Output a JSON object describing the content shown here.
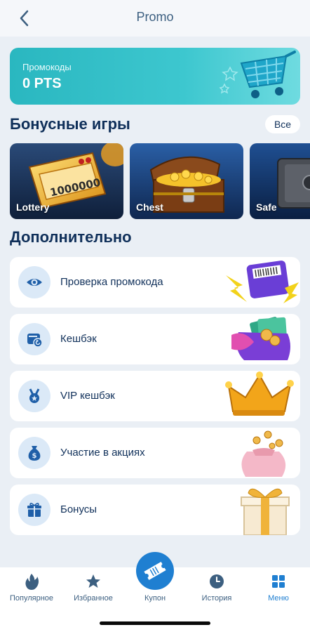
{
  "header": {
    "title": "Promo"
  },
  "promo": {
    "label": "Промокоды",
    "value": "0 PTS"
  },
  "bonus_games": {
    "title": "Бонусные игры",
    "all_label": "Все",
    "items": [
      {
        "label": "Lottery",
        "ticket_text": "1000000"
      },
      {
        "label": "Chest"
      },
      {
        "label": "Safe"
      }
    ]
  },
  "additional": {
    "title": "Дополнительно",
    "items": [
      {
        "label": "Проверка промокода",
        "icon": "eye-icon"
      },
      {
        "label": "Кешбэк",
        "icon": "wallet-cashback-icon"
      },
      {
        "label": "VIP кешбэк",
        "icon": "medal-icon"
      },
      {
        "label": "Участие в акциях",
        "icon": "money-bag-icon"
      },
      {
        "label": "Бонусы",
        "icon": "gift-icon"
      }
    ]
  },
  "tabbar": {
    "items": [
      {
        "label": "Популярное",
        "icon": "flame-icon"
      },
      {
        "label": "Избранное",
        "icon": "star-icon"
      },
      {
        "label": "Купон",
        "icon": "ticket-icon"
      },
      {
        "label": "История",
        "icon": "clock-icon"
      },
      {
        "label": "Меню",
        "icon": "grid-icon"
      }
    ]
  },
  "colors": {
    "accent": "#1f7fd1",
    "promo_card": "#2ab7c0",
    "background": "#eaeff5",
    "text": "#10305a"
  }
}
